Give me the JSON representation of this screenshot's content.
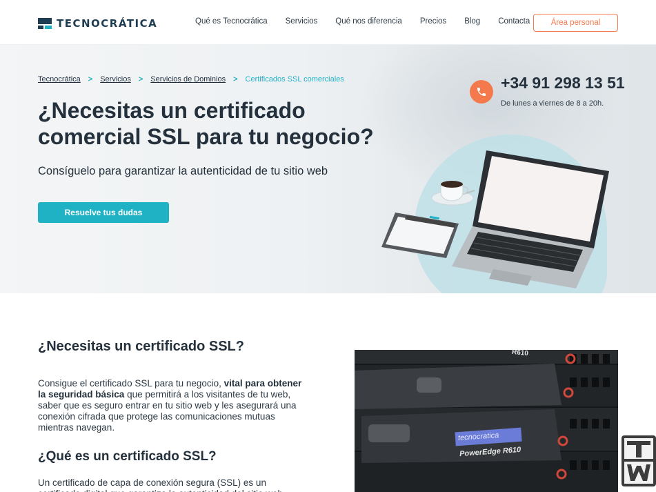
{
  "brand": {
    "logo_text": "TECNOCRÁTICA"
  },
  "nav": {
    "items": [
      "Qué es Tecnocrática",
      "Servicios",
      "Qué nos diferencia",
      "Precios",
      "Blog",
      "Contacta"
    ],
    "area_button": "Área personal"
  },
  "breadcrumb": {
    "items": [
      "Tecnocrática",
      "Servicios",
      "Servicios de Dominios"
    ],
    "separator": ">",
    "current": "Certificados SSL comerciales"
  },
  "hero": {
    "title_line1": "¿Necesitas un certificado",
    "title_line2": "comercial SSL para tu negocio?",
    "subtitle": "Consíguelo para garantizar la autenticidad de tu sitio web",
    "cta": "Resuelve tus dudas",
    "phone": "+34 91 298 13 51",
    "hours": "De lunes a viernes de 8 a 20h."
  },
  "section1": {
    "title": "¿Necesitas un certificado SSL?",
    "p_start": "Consigue el certificado SSL para tu negocio, ",
    "p_bold": "vital para obtener la seguridad básica",
    "p_end": " que permitirá a los visitantes de tu web, saber que es seguro entrar en tu sitio web y les asegurará una conexión cifrada que protege las comunicaciones mutuas mientras navegan."
  },
  "section2": {
    "title": "¿Qué es un certificado SSL?",
    "p": "Un certificado de capa de conexión segura (SSL) es un certificado digital que garantiza la autenticidad del sitio web"
  },
  "server_image": {
    "label1": "tecnocratica",
    "label2": "PowerEdge R610",
    "label3": "R610"
  },
  "colors": {
    "accent": "#1fb2c5",
    "orange": "#f47a4d",
    "dark": "#24313c"
  },
  "icons": [
    "phone-icon",
    "chevron-right-icon"
  ]
}
